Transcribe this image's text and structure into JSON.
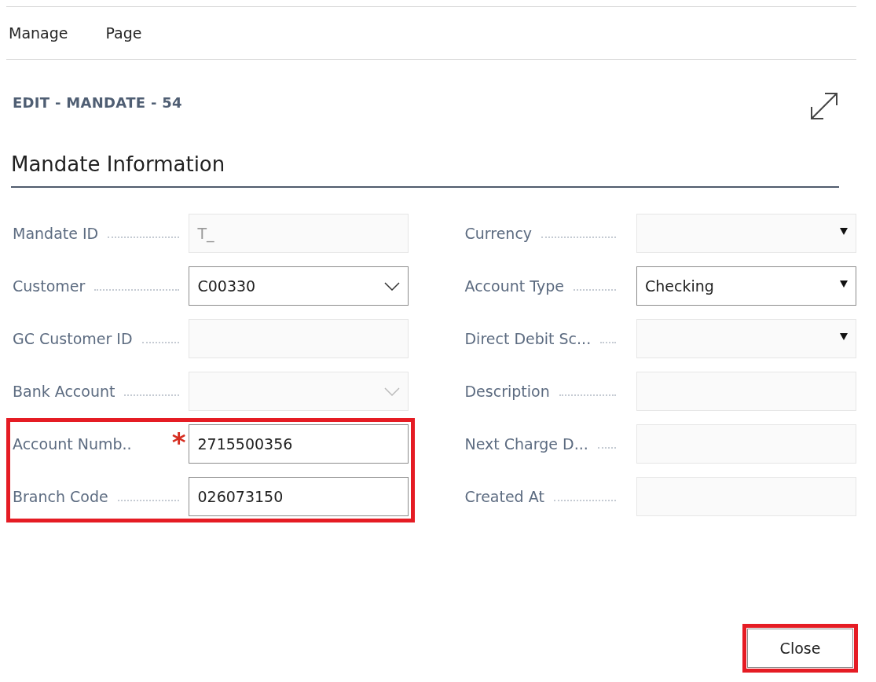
{
  "menu": [
    {
      "label": "Manage"
    },
    {
      "label": "Page"
    }
  ],
  "page_title": "EDIT - MANDATE - 54",
  "section": {
    "title": "Mandate Information"
  },
  "columns": [
    [
      {
        "label": "Mandate ID",
        "kind": "text",
        "value": "T_",
        "editable": false,
        "highlighted": false
      },
      {
        "label": "Customer",
        "kind": "lookup",
        "value": "C00330",
        "editable": true,
        "highlighted": false
      },
      {
        "label": "GC Customer ID",
        "kind": "text",
        "editable": false,
        "highlighted": false
      },
      {
        "label": "Bank Account",
        "kind": "lookup",
        "editable": false,
        "highlighted": false
      },
      {
        "label": "Account Numb..",
        "kind": "text",
        "value": "2715500356",
        "editable": true,
        "required_mark": "*",
        "highlighted": true
      },
      {
        "label": "Branch Code",
        "kind": "text",
        "value": "026073150",
        "editable": true,
        "highlighted": true
      }
    ],
    [
      {
        "label": "Currency",
        "kind": "option",
        "editable": false,
        "highlighted": false
      },
      {
        "label": "Account Type",
        "kind": "option",
        "value": "Checking",
        "editable": true,
        "highlighted": false
      },
      {
        "label": "Direct Debit Sc...",
        "kind": "option",
        "editable": false,
        "highlighted": false
      },
      {
        "label": "Description",
        "kind": "text",
        "editable": false,
        "highlighted": false
      },
      {
        "label": "Next Charge D...",
        "kind": "text",
        "editable": false,
        "highlighted": false
      },
      {
        "label": "Created At",
        "kind": "text",
        "editable": false,
        "highlighted": false
      }
    ]
  ],
  "close_button": {
    "label": "Close",
    "highlighted": true
  }
}
